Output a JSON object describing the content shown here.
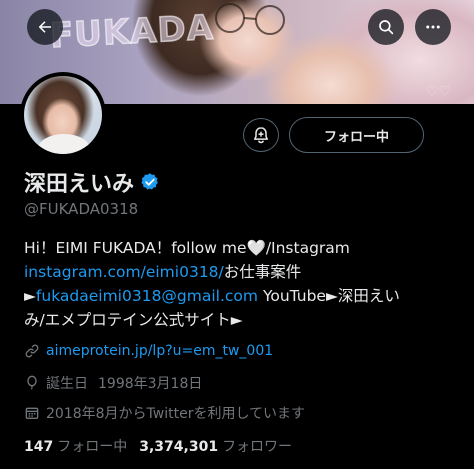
{
  "banner": {
    "text": "FUKADA"
  },
  "header": {
    "back_icon": "arrow-left-icon",
    "search_icon": "search-icon",
    "more_icon": "more-horizontal-icon"
  },
  "actions": {
    "notify_icon": "bell-plus-icon",
    "follow_label": "フォロー中"
  },
  "profile": {
    "display_name": "深田えいみ",
    "verified": true,
    "handle": "@FUKADA0318"
  },
  "bio": {
    "line1_text": "Hi！EIMI FUKADA！follow me",
    "line1_heart": "🤍",
    "line1_after": "/Instagram",
    "instagram_link": "instagram.com/eimi0318/",
    "line2_after": "お仕事案件",
    "arrow1": "►",
    "email_link": "fukadaeimi0318@gmail.com",
    "line3_after": " YouTube►深田えい",
    "line4": "み/エメプロテイン公式サイト►"
  },
  "meta": {
    "url": "aimeprotein.jp/lp?u=em_tw_001",
    "birth_label": "誕生日",
    "birth_date": "1998年3月18日",
    "joined": "2018年8月からTwitterを利用しています"
  },
  "stats": {
    "following_count": "147",
    "following_label": "フォロー中",
    "followers_count": "3,374,301",
    "followers_label": "フォロワー"
  },
  "colors": {
    "background": "#000000",
    "accent": "#1d9bf0",
    "text_primary": "#e7e9ea",
    "text_secondary": "#71767b"
  }
}
